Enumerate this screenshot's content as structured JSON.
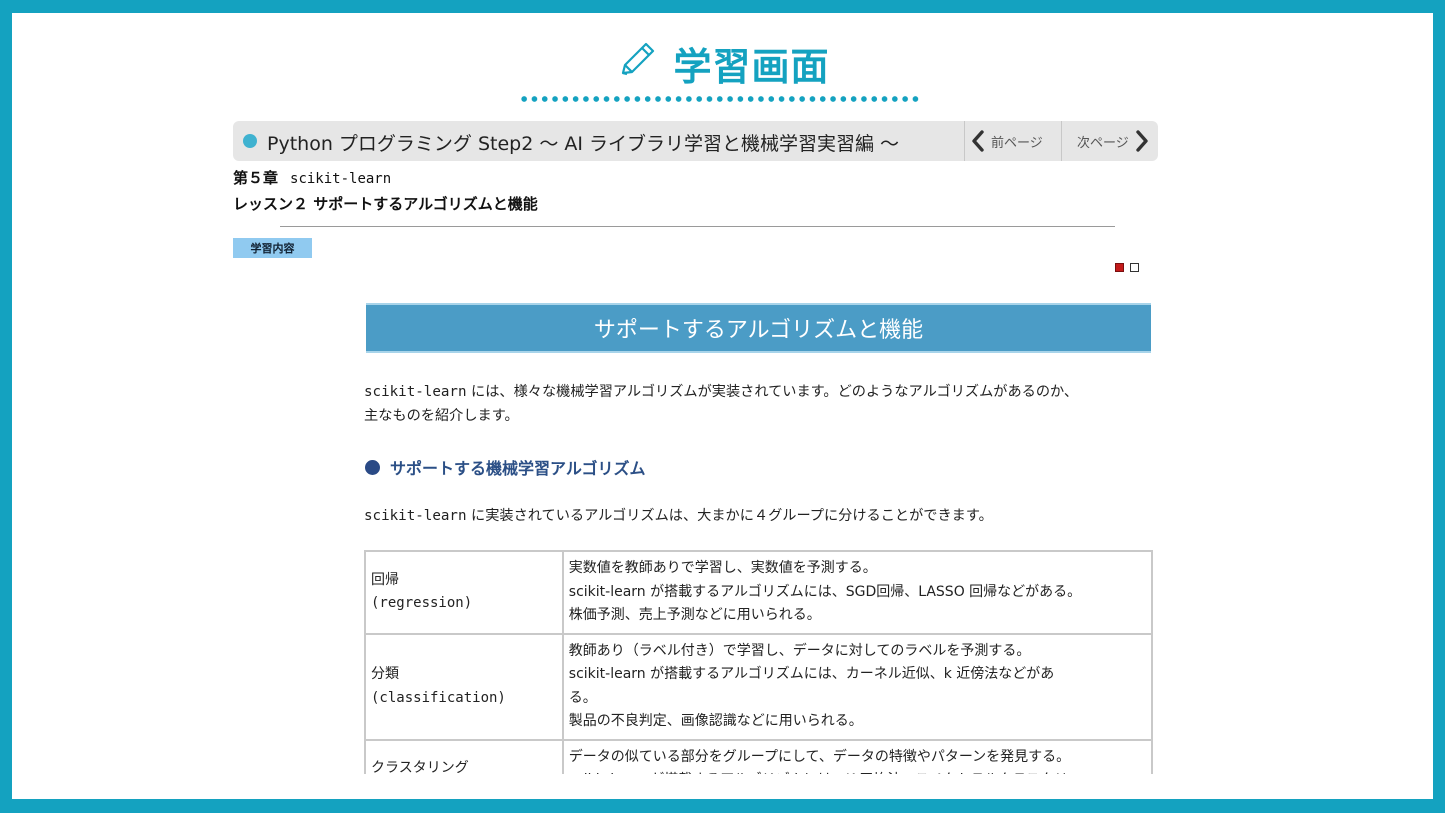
{
  "header": {
    "icon": "pencil-icon",
    "title": "学習画面",
    "accent": "#14a2c0"
  },
  "course": {
    "title": "Python プログラミング Step2 ～ AI ライブラリ学習と機械学習実習編 ～",
    "prev_label": "前ページ",
    "next_label": "次ページ"
  },
  "chapter": {
    "label": "第５章",
    "name": "scikit-learn"
  },
  "lesson": {
    "title": "レッスン２ サポートするアルゴリズムと機能"
  },
  "badge": "学習内容",
  "pager": {
    "current": 1,
    "total": 2
  },
  "section": {
    "heading": "サポートするアルゴリズムと機能",
    "intro_code": "scikit-learn",
    "intro_line1": " には、様々な機械学習アルゴリズムが実装されています。どのようなアルゴリズムがあるのか、",
    "intro_line2": "主なものを紹介します。",
    "subheading": "サポートする機械学習アルゴリズム",
    "para_code": "scikit-learn",
    "para_text": " に実装されているアルゴリズムは、大まかに４グループに分けることができます。"
  },
  "table": {
    "rows": [
      {
        "name": "回帰",
        "english": "(regression)",
        "lines": [
          "実数値を教師ありで学習し、実数値を予測する。",
          "scikit-learn が搭載するアルゴリズムには、SGD回帰、LASSO 回帰などがある。",
          "株価予測、売上予測などに用いられる。"
        ]
      },
      {
        "name": "分類",
        "english": "(classification)",
        "lines": [
          "教師あり（ラベル付き）で学習し、データに対してのラベルを予測する。",
          "scikit-learn が搭載するアルゴリズムには、カーネル近似、k 近傍法などがあ",
          "る。",
          "製品の不良判定、画像認識などに用いられる。"
        ]
      },
      {
        "name": "クラスタリング",
        "english": "",
        "lines": [
          "データの似ている部分をグループにして、データの特徴やパターンを発見する。",
          "scikit-learn が搭載するアルゴリズムには、K 平均法、スペクトラルクラスタリ"
        ]
      }
    ]
  }
}
